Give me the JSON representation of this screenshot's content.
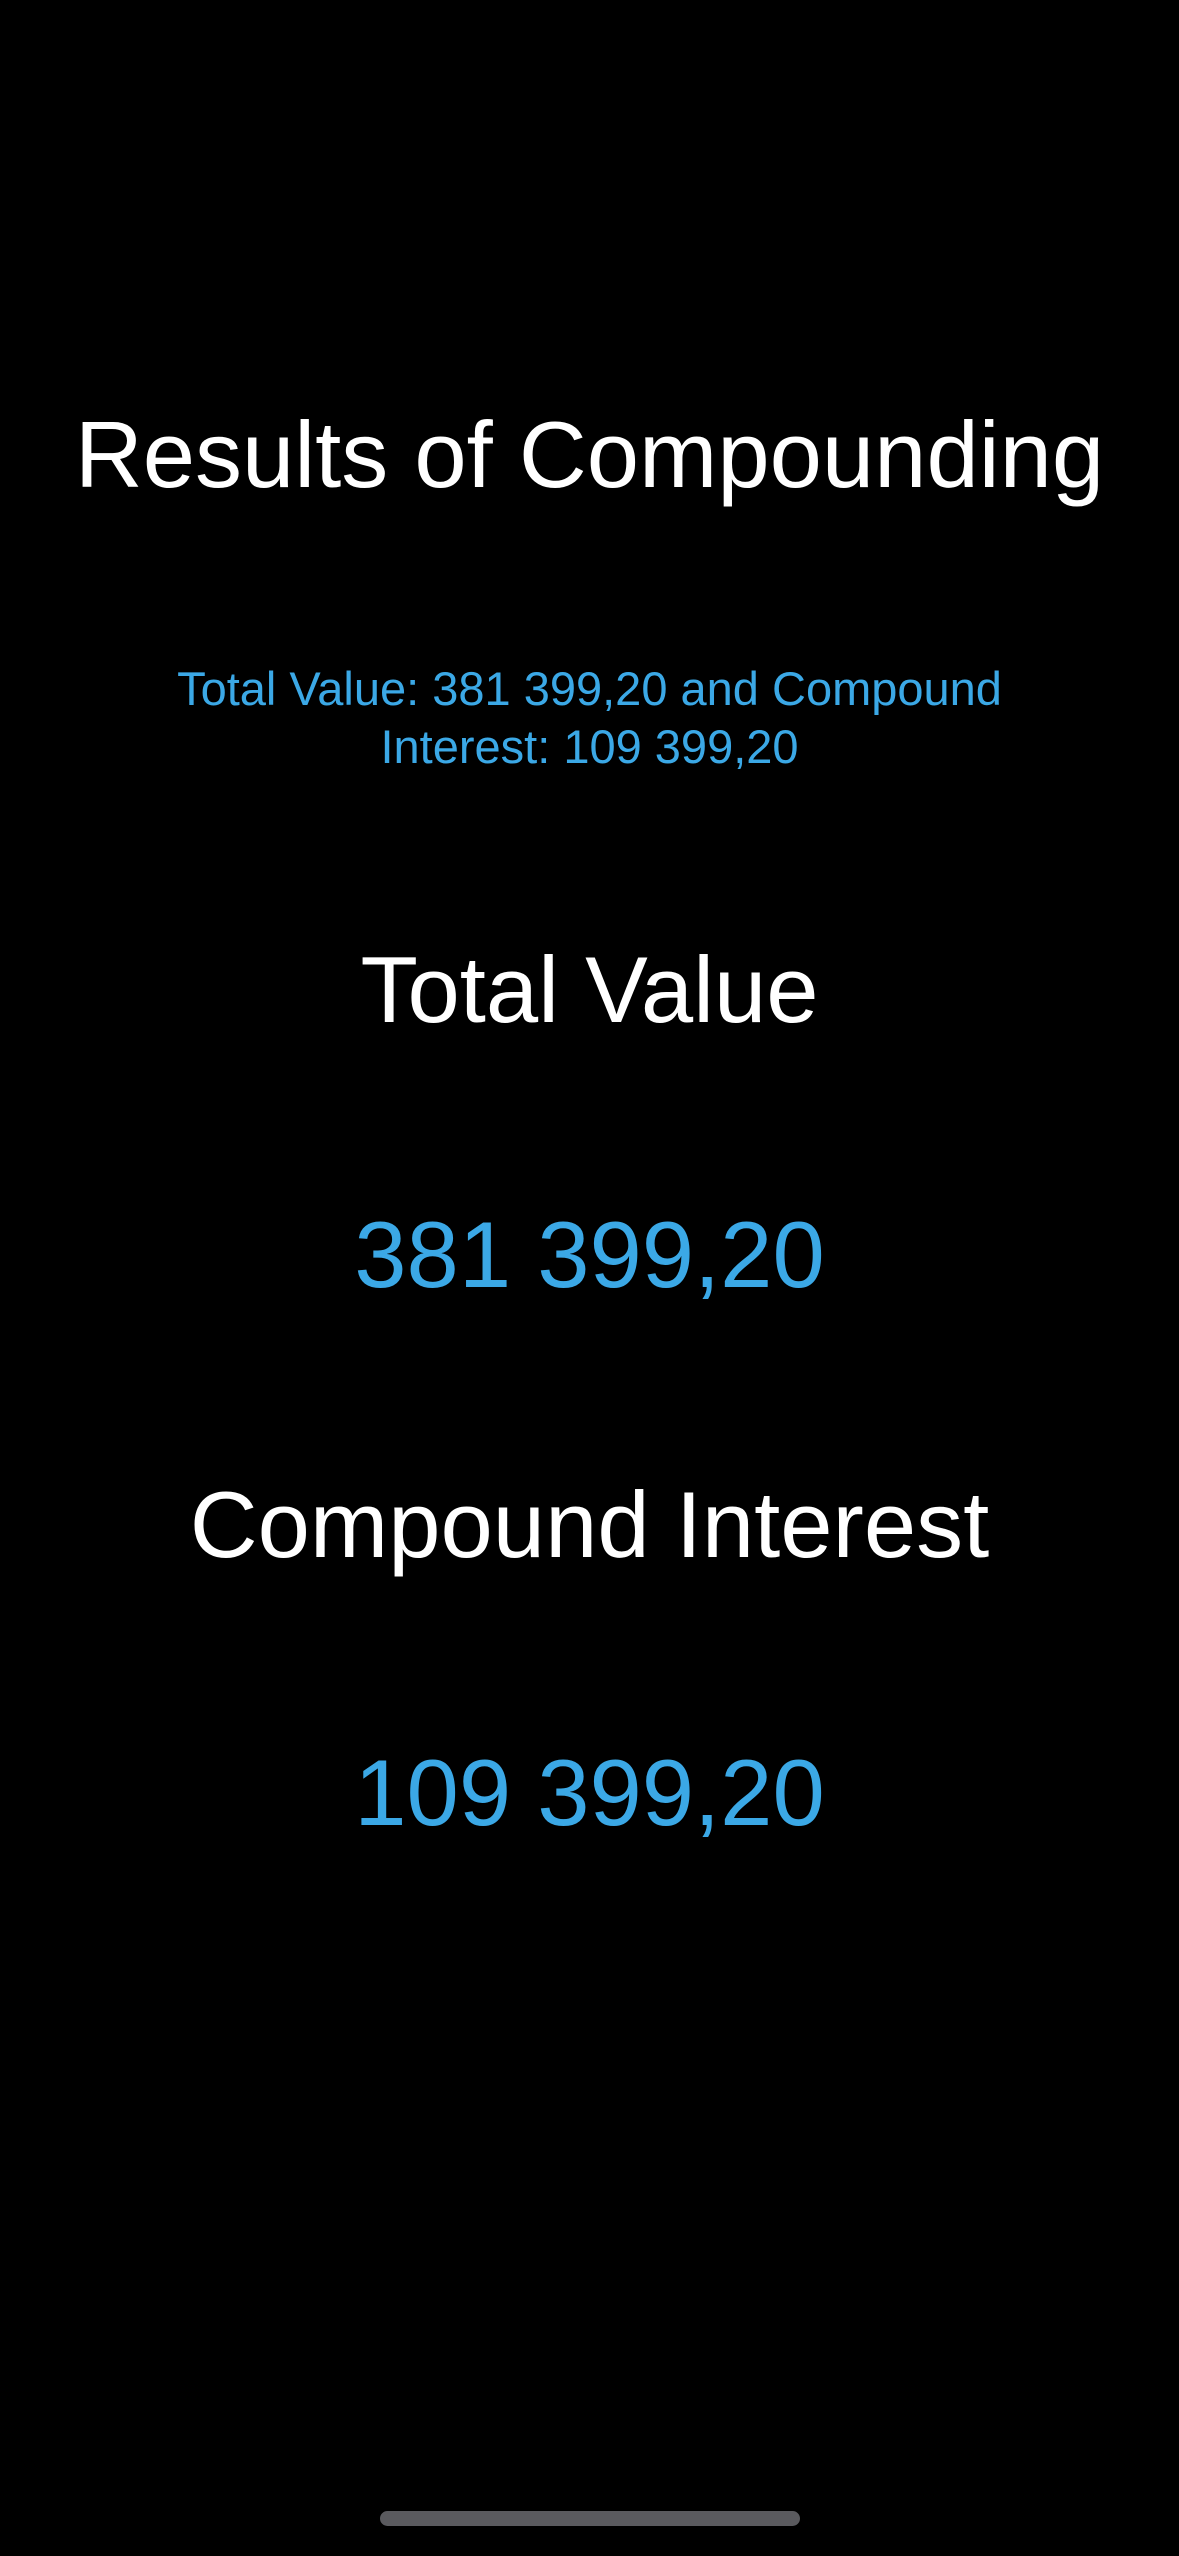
{
  "colors": {
    "background": "#000000",
    "text_primary": "#ffffff",
    "accent": "#3ba8e6",
    "home_indicator": "#5a5a5e"
  },
  "screen": {
    "title": "Results of Compounding",
    "summary": "Total Value: 381 399,20 and Compound Interest: 109 399,20",
    "total_value_label": "Total Value",
    "total_value": "381 399,20",
    "compound_interest_label": "Compound Interest",
    "compound_interest": "109 399,20"
  }
}
